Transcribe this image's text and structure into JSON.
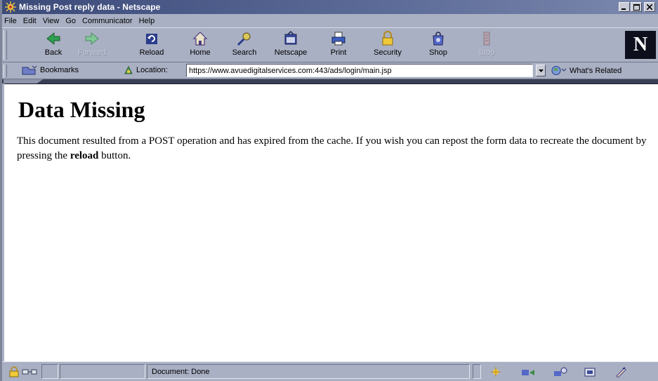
{
  "window": {
    "title": "Missing Post reply data - Netscape"
  },
  "menubar": {
    "items": [
      "File",
      "Edit",
      "View",
      "Go",
      "Communicator",
      "Help"
    ]
  },
  "toolbar": {
    "buttons": [
      {
        "label": "Back",
        "icon": "back-arrow-icon"
      },
      {
        "label": "Forward",
        "icon": "forward-arrow-icon",
        "disabled": true
      },
      {
        "label": "Reload",
        "icon": "reload-icon"
      },
      {
        "label": "Home",
        "icon": "home-icon"
      },
      {
        "label": "Search",
        "icon": "search-icon"
      },
      {
        "label": "Netscape",
        "icon": "netscape-icon"
      },
      {
        "label": "Print",
        "icon": "print-icon"
      },
      {
        "label": "Security",
        "icon": "security-lock-icon"
      },
      {
        "label": "Shop",
        "icon": "shop-icon"
      },
      {
        "label": "Stop",
        "icon": "stop-icon",
        "disabled": true
      }
    ],
    "logo": "N"
  },
  "locationbar": {
    "bookmarks_label": "Bookmarks",
    "location_label": "Location:",
    "url": "https://www.avuedigitalservices.com:443/ads/login/main.jsp",
    "related_label": "What's Related"
  },
  "page": {
    "heading": "Data Missing",
    "body_prefix": "This document resulted from a POST operation and has expired from the cache. If you wish you can repost the form data to recreate the document by pressing the ",
    "body_bold": "reload",
    "body_suffix": " button."
  },
  "statusbar": {
    "status": "Document: Done"
  },
  "colors": {
    "titlebar": "#3b4a79",
    "chrome": "#a9b0c3",
    "content_bg": "#ffffff"
  }
}
